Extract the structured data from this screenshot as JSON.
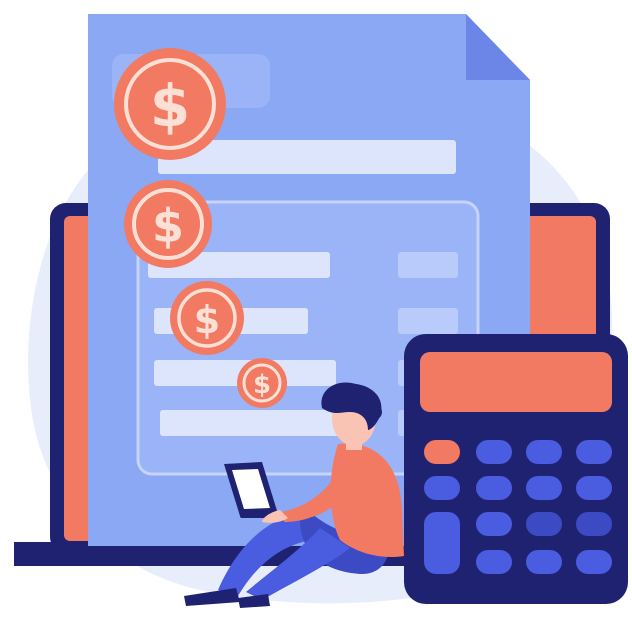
{
  "illustration": {
    "coins": [
      {
        "symbol": "$"
      },
      {
        "symbol": "$"
      },
      {
        "symbol": "$"
      },
      {
        "symbol": "$"
      }
    ],
    "colors": {
      "background_blob": "#e8edfb",
      "document": "#8aa8f4",
      "document_fold": "#6c86e8",
      "document_lines": "#dde5fd",
      "laptop_frame": "#1e2270",
      "laptop_screen": "#f27a62",
      "calculator_body": "#1e2270",
      "calculator_display": "#f27a62",
      "calculator_keys": "#4a5ce0",
      "calculator_accent_key": "#f27a62",
      "coin_fill": "#f27a62",
      "coin_glyph": "#fce0d6",
      "person_shirt": "#f27a62",
      "person_pants": "#4a5ce0",
      "person_hair": "#1e2270"
    },
    "icons": [
      "document-icon",
      "coin-icon",
      "laptop-icon",
      "calculator-icon",
      "person-icon"
    ]
  }
}
